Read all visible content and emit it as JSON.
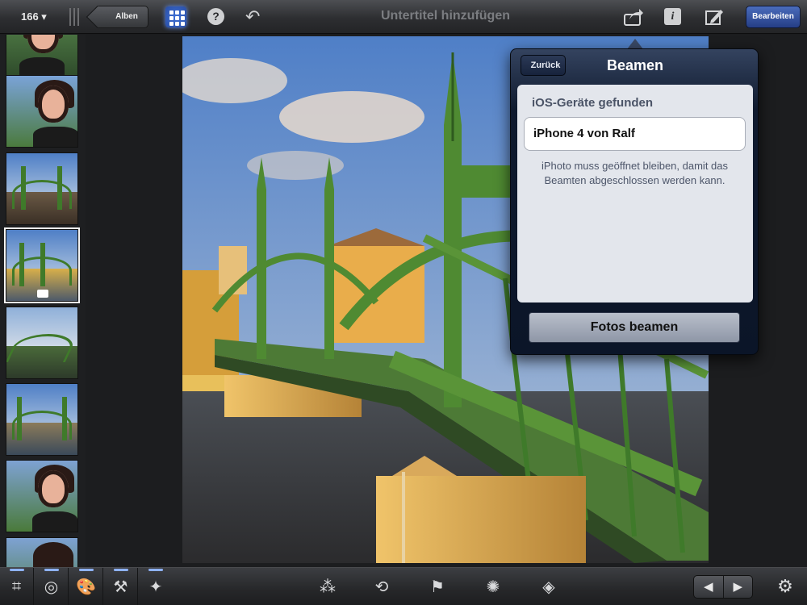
{
  "topbar": {
    "photo_count": "166 ▾",
    "back_label": "Alben",
    "help_glyph": "?",
    "undo_glyph": "↶",
    "subtitle_placeholder": "Untertitel hinzufügen",
    "info_glyph": "i",
    "edit_label": "Bearbeiten"
  },
  "sidebar": {
    "thumbnails": [
      {
        "kind": "portrait",
        "selected": false
      },
      {
        "kind": "portrait",
        "selected": false
      },
      {
        "kind": "bridge",
        "selected": false
      },
      {
        "kind": "bridge",
        "selected": true
      },
      {
        "kind": "bridge",
        "selected": false
      },
      {
        "kind": "bridge",
        "selected": false
      },
      {
        "kind": "portrait",
        "selected": false
      },
      {
        "kind": "portrait",
        "selected": false
      }
    ]
  },
  "popover": {
    "back_label": "Zurück",
    "title": "Beamen",
    "section_heading": "iOS-Geräte gefunden",
    "device_name": "iPhone 4 von Ralf",
    "note": "iPhoto muss geöffnet bleiben, damit das Beamten abgeschlossen werden kann.",
    "action_label": "Fotos beamen"
  },
  "bottombar": {
    "tools_left": [
      {
        "icon": "crop-icon",
        "glyph": "⌗"
      },
      {
        "icon": "exposure-icon",
        "glyph": "◎"
      },
      {
        "icon": "color-palette-icon",
        "glyph": "🎨"
      },
      {
        "icon": "brushes-icon",
        "glyph": "⚒"
      },
      {
        "icon": "effects-icon",
        "glyph": "✦"
      }
    ],
    "tools_center": [
      {
        "icon": "magic-wand-icon",
        "glyph": "⁂"
      },
      {
        "icon": "rotate-icon",
        "glyph": "⟲"
      },
      {
        "icon": "flag-icon",
        "glyph": "⚑"
      },
      {
        "icon": "favorite-rosette-icon",
        "glyph": "✺"
      },
      {
        "icon": "tag-icon",
        "glyph": "◈"
      }
    ],
    "prev_glyph": "◀",
    "next_glyph": "▶",
    "settings_glyph": "⚙"
  },
  "colors": {
    "accent_blue": "#3d6fd6",
    "popover_bg": "#0f1a2e",
    "bridge_green": "#3f7a2a"
  }
}
